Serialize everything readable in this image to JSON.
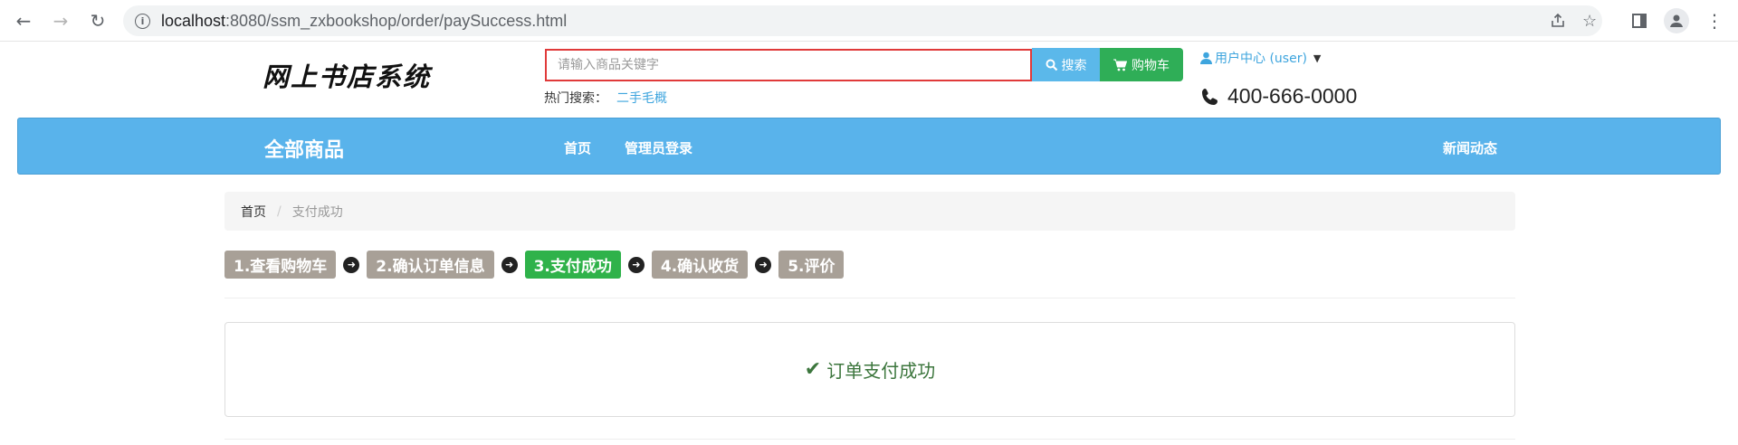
{
  "browser": {
    "url_host": "localhost",
    "url_path": ":8080/ssm_zxbookshop/order/paySuccess.html",
    "icons": [
      "back-icon",
      "forward-icon",
      "reload-icon",
      "info-icon",
      "share-icon",
      "star-icon",
      "side-panel-icon",
      "profile-icon",
      "menu-icon"
    ]
  },
  "header": {
    "logo_text": "网上书店系统",
    "search": {
      "placeholder": "请输入商品关键字",
      "value": "",
      "button_label": "搜索"
    },
    "cart_label": "购物车",
    "hot_search_label": "热门搜索：",
    "hot_search_link": "二手毛概",
    "user_center": "用户中心 (user)",
    "phone": "400-666-0000"
  },
  "nav": {
    "all_products": "全部商品",
    "links": [
      "首页",
      "管理员登录"
    ],
    "right_link": "新闻动态",
    "bg_color": "#59b3eb"
  },
  "breadcrumb": {
    "home": "首页",
    "separator": "/",
    "current": "支付成功"
  },
  "steps": [
    {
      "label": "1.查看购物车",
      "active": false
    },
    {
      "label": "2.确认订单信息",
      "active": false
    },
    {
      "label": "3.支付成功",
      "active": true
    },
    {
      "label": "4.确认收货",
      "active": false
    },
    {
      "label": "5.评价",
      "active": false
    }
  ],
  "status": {
    "message": "订单支付成功",
    "color": "#3c763d"
  },
  "colors": {
    "step_inactive": "#a8a097",
    "step_active": "#2fb24a",
    "search_button": "#5bb8ea",
    "cart_button": "#2fae57",
    "search_border": "#e03a3a"
  }
}
